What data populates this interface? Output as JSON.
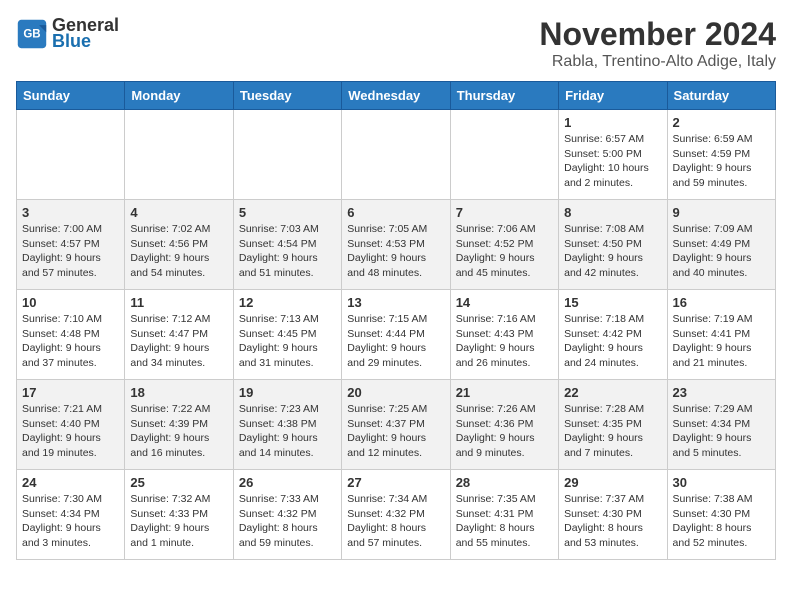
{
  "header": {
    "logo_line1": "General",
    "logo_line2": "Blue",
    "month_title": "November 2024",
    "location": "Rabla, Trentino-Alto Adige, Italy"
  },
  "days_of_week": [
    "Sunday",
    "Monday",
    "Tuesday",
    "Wednesday",
    "Thursday",
    "Friday",
    "Saturday"
  ],
  "weeks": [
    [
      {
        "day": "",
        "info": ""
      },
      {
        "day": "",
        "info": ""
      },
      {
        "day": "",
        "info": ""
      },
      {
        "day": "",
        "info": ""
      },
      {
        "day": "",
        "info": ""
      },
      {
        "day": "1",
        "info": "Sunrise: 6:57 AM\nSunset: 5:00 PM\nDaylight: 10 hours and 2 minutes."
      },
      {
        "day": "2",
        "info": "Sunrise: 6:59 AM\nSunset: 4:59 PM\nDaylight: 9 hours and 59 minutes."
      }
    ],
    [
      {
        "day": "3",
        "info": "Sunrise: 7:00 AM\nSunset: 4:57 PM\nDaylight: 9 hours and 57 minutes."
      },
      {
        "day": "4",
        "info": "Sunrise: 7:02 AM\nSunset: 4:56 PM\nDaylight: 9 hours and 54 minutes."
      },
      {
        "day": "5",
        "info": "Sunrise: 7:03 AM\nSunset: 4:54 PM\nDaylight: 9 hours and 51 minutes."
      },
      {
        "day": "6",
        "info": "Sunrise: 7:05 AM\nSunset: 4:53 PM\nDaylight: 9 hours and 48 minutes."
      },
      {
        "day": "7",
        "info": "Sunrise: 7:06 AM\nSunset: 4:52 PM\nDaylight: 9 hours and 45 minutes."
      },
      {
        "day": "8",
        "info": "Sunrise: 7:08 AM\nSunset: 4:50 PM\nDaylight: 9 hours and 42 minutes."
      },
      {
        "day": "9",
        "info": "Sunrise: 7:09 AM\nSunset: 4:49 PM\nDaylight: 9 hours and 40 minutes."
      }
    ],
    [
      {
        "day": "10",
        "info": "Sunrise: 7:10 AM\nSunset: 4:48 PM\nDaylight: 9 hours and 37 minutes."
      },
      {
        "day": "11",
        "info": "Sunrise: 7:12 AM\nSunset: 4:47 PM\nDaylight: 9 hours and 34 minutes."
      },
      {
        "day": "12",
        "info": "Sunrise: 7:13 AM\nSunset: 4:45 PM\nDaylight: 9 hours and 31 minutes."
      },
      {
        "day": "13",
        "info": "Sunrise: 7:15 AM\nSunset: 4:44 PM\nDaylight: 9 hours and 29 minutes."
      },
      {
        "day": "14",
        "info": "Sunrise: 7:16 AM\nSunset: 4:43 PM\nDaylight: 9 hours and 26 minutes."
      },
      {
        "day": "15",
        "info": "Sunrise: 7:18 AM\nSunset: 4:42 PM\nDaylight: 9 hours and 24 minutes."
      },
      {
        "day": "16",
        "info": "Sunrise: 7:19 AM\nSunset: 4:41 PM\nDaylight: 9 hours and 21 minutes."
      }
    ],
    [
      {
        "day": "17",
        "info": "Sunrise: 7:21 AM\nSunset: 4:40 PM\nDaylight: 9 hours and 19 minutes."
      },
      {
        "day": "18",
        "info": "Sunrise: 7:22 AM\nSunset: 4:39 PM\nDaylight: 9 hours and 16 minutes."
      },
      {
        "day": "19",
        "info": "Sunrise: 7:23 AM\nSunset: 4:38 PM\nDaylight: 9 hours and 14 minutes."
      },
      {
        "day": "20",
        "info": "Sunrise: 7:25 AM\nSunset: 4:37 PM\nDaylight: 9 hours and 12 minutes."
      },
      {
        "day": "21",
        "info": "Sunrise: 7:26 AM\nSunset: 4:36 PM\nDaylight: 9 hours and 9 minutes."
      },
      {
        "day": "22",
        "info": "Sunrise: 7:28 AM\nSunset: 4:35 PM\nDaylight: 9 hours and 7 minutes."
      },
      {
        "day": "23",
        "info": "Sunrise: 7:29 AM\nSunset: 4:34 PM\nDaylight: 9 hours and 5 minutes."
      }
    ],
    [
      {
        "day": "24",
        "info": "Sunrise: 7:30 AM\nSunset: 4:34 PM\nDaylight: 9 hours and 3 minutes."
      },
      {
        "day": "25",
        "info": "Sunrise: 7:32 AM\nSunset: 4:33 PM\nDaylight: 9 hours and 1 minute."
      },
      {
        "day": "26",
        "info": "Sunrise: 7:33 AM\nSunset: 4:32 PM\nDaylight: 8 hours and 59 minutes."
      },
      {
        "day": "27",
        "info": "Sunrise: 7:34 AM\nSunset: 4:32 PM\nDaylight: 8 hours and 57 minutes."
      },
      {
        "day": "28",
        "info": "Sunrise: 7:35 AM\nSunset: 4:31 PM\nDaylight: 8 hours and 55 minutes."
      },
      {
        "day": "29",
        "info": "Sunrise: 7:37 AM\nSunset: 4:30 PM\nDaylight: 8 hours and 53 minutes."
      },
      {
        "day": "30",
        "info": "Sunrise: 7:38 AM\nSunset: 4:30 PM\nDaylight: 8 hours and 52 minutes."
      }
    ]
  ]
}
